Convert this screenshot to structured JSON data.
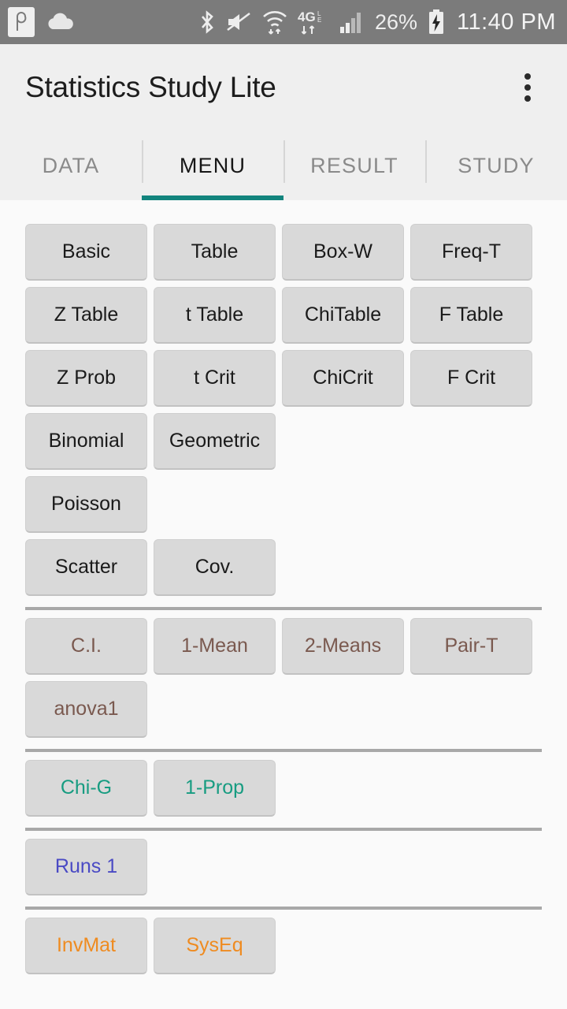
{
  "statusbar": {
    "left_icons": [
      {
        "name": "capture-badge-icon",
        "glyph": "ρ"
      },
      {
        "name": "cloud-icon",
        "glyph": "cloud"
      }
    ],
    "right_icons": [
      {
        "name": "bluetooth-icon",
        "glyph": "bluetooth"
      },
      {
        "name": "mute-icon",
        "glyph": "speaker-muted"
      },
      {
        "name": "wifi-icon",
        "glyph": "wifi-transfer"
      },
      {
        "name": "lte-4g-icon",
        "glyph": "4G-LTE-transfer"
      },
      {
        "name": "cellular-signal-icon",
        "glyph": "signal-bars"
      }
    ],
    "battery_percent": "26%",
    "battery_state": "charging",
    "clock": "11:40 PM"
  },
  "appbar": {
    "title": "Statistics Study Lite",
    "overflow_label": "More options"
  },
  "tabs": {
    "active_index": 1,
    "items": [
      {
        "label": "DATA"
      },
      {
        "label": "MENU"
      },
      {
        "label": "RESULT"
      },
      {
        "label": "STUDY"
      }
    ],
    "indicator_color": "#12847d"
  },
  "colors": {
    "default_text": "#1a1a1a",
    "brown_text": "#7a594f",
    "teal_text": "#179c81",
    "blue_text": "#4a4ac4",
    "orange_text": "#ef8b20",
    "button_bg": "#d9d9d9",
    "divider": "#a8a8a8",
    "page_bg": "#fafafa",
    "appbar_bg": "#efefef",
    "statusbar_bg": "#7b7b7b"
  },
  "menu": {
    "groups": [
      {
        "name": "descriptive-and-distributions",
        "color": "default",
        "rows": [
          [
            "Basic",
            "Table",
            "Box-W",
            "Freq-T"
          ],
          [
            "Z Table",
            "t Table",
            "ChiTable",
            "F Table"
          ],
          [
            "Z Prob",
            "t Crit",
            "ChiCrit",
            "F Crit"
          ],
          [
            "Binomial",
            "Geometric"
          ],
          [
            "Poisson"
          ],
          [
            "Scatter",
            "Cov."
          ]
        ]
      },
      {
        "name": "inference-means",
        "color": "brown",
        "rows": [
          [
            "C.I.",
            "1-Mean",
            "2-Means",
            "Pair-T"
          ],
          [
            "anova1"
          ]
        ]
      },
      {
        "name": "inference-proportions",
        "color": "teal",
        "rows": [
          [
            "Chi-G",
            "1-Prop"
          ]
        ]
      },
      {
        "name": "nonparametric",
        "color": "blue",
        "rows": [
          [
            "Runs 1"
          ]
        ]
      },
      {
        "name": "matrix-tools",
        "color": "orange",
        "rows": [
          [
            "InvMat",
            "SysEq"
          ]
        ]
      }
    ]
  }
}
